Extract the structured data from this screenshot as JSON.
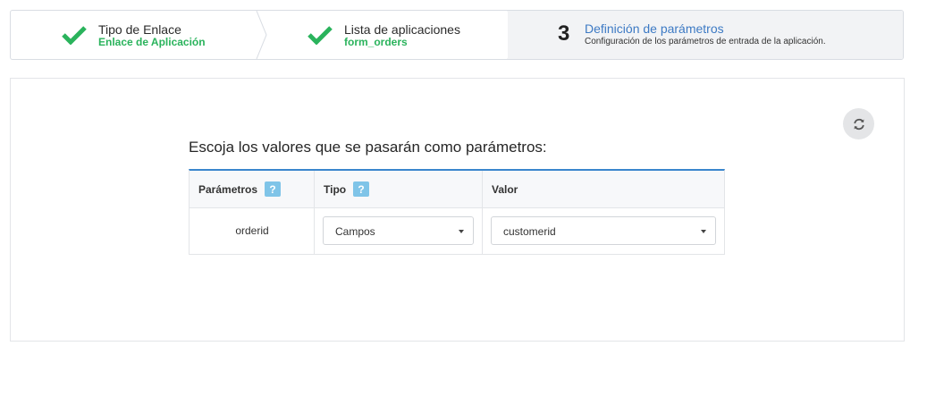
{
  "wizard": {
    "steps": [
      {
        "title": "Tipo de Enlace",
        "subtitle": "Enlace de Aplicación",
        "icon": "check-icon",
        "status": "done"
      },
      {
        "title": "Lista de aplicaciones",
        "subtitle": "form_orders",
        "icon": "check-icon",
        "status": "done"
      },
      {
        "number": "3",
        "title": "Definición de parámetros",
        "description": "Configuración de los parámetros de entrada de la aplicación.",
        "status": "active"
      }
    ],
    "colors": {
      "done": "#2ab35c",
      "active_title": "#3d7ac4",
      "active_bg": "#f2f3f5"
    }
  },
  "panel": {
    "refresh_icon": "refresh-icon",
    "heading": "Escoja los valores que se pasarán como parámetros:",
    "table": {
      "headers": [
        {
          "label": "Parámetros",
          "help": "?"
        },
        {
          "label": "Tipo",
          "help": "?"
        },
        {
          "label": "Valor"
        }
      ],
      "rows": [
        {
          "parameter": "orderid",
          "type": "Campos",
          "value": "customerid"
        }
      ],
      "accent": "#3a86cd"
    }
  }
}
